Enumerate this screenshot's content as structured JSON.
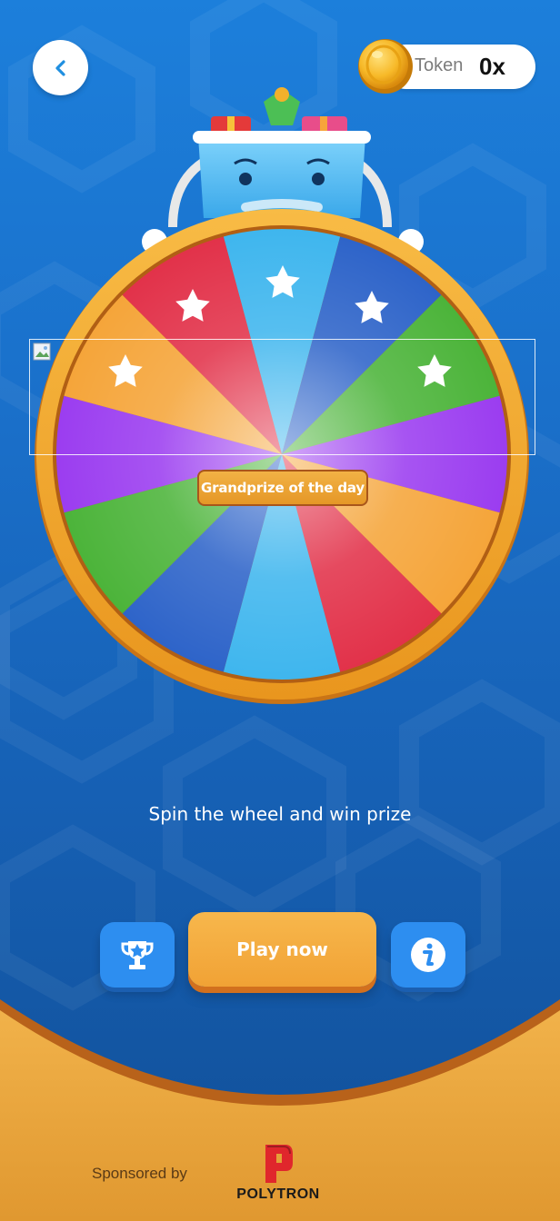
{
  "header": {
    "back_icon": "chevron-left-icon",
    "token": {
      "label": "Token",
      "value": "0x",
      "icon": "coin-icon"
    }
  },
  "wheel": {
    "center_label": "Grandprize of the day",
    "segment_colors": [
      "#3fb6ee",
      "#2e64c9",
      "#4cb43a",
      "#9b3df0",
      "#f5a53a",
      "#e2324a",
      "#3fb6ee",
      "#2e64c9",
      "#4cb43a",
      "#9b3df0",
      "#f5a53a",
      "#e2324a"
    ],
    "rim_color": "#f5ac35",
    "star_icon": "star-icon",
    "broken_image_icon": "broken-image-icon"
  },
  "main": {
    "tagline": "Spin the wheel and win prize",
    "play_label": "Play now",
    "leaderboard_icon": "trophy-icon",
    "info_icon": "info-icon"
  },
  "footer": {
    "sponsored_label": "Sponsored by",
    "sponsor_name": "POLYTRON",
    "sponsor_logo_icon": "polytron-logo-icon"
  },
  "colors": {
    "background": "#1a6fc9",
    "accent_orange": "#f1a235",
    "button_blue": "#2d8ef0",
    "footer_gold": "#e7a13a"
  }
}
